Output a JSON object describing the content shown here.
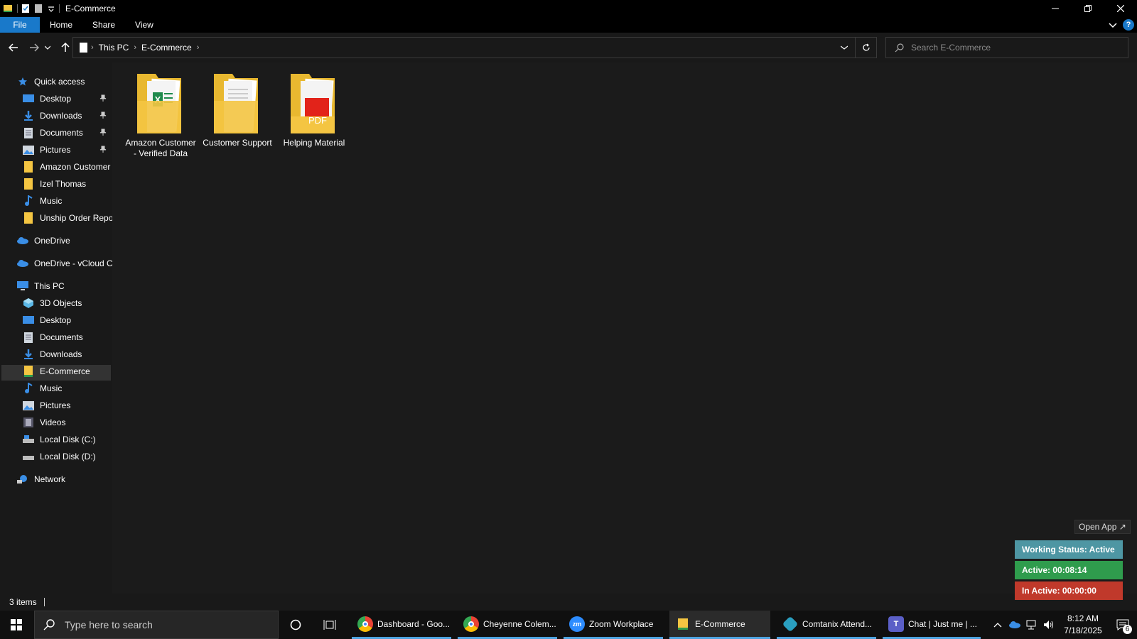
{
  "window": {
    "title": "E-Commerce"
  },
  "ribbon": {
    "tabs": [
      {
        "label": "File"
      },
      {
        "label": "Home"
      },
      {
        "label": "Share"
      },
      {
        "label": "View"
      }
    ],
    "help_label": "?"
  },
  "address": {
    "crumbs": [
      "This PC",
      "E-Commerce"
    ]
  },
  "search": {
    "placeholder": "Search E-Commerce"
  },
  "sidebar": {
    "quick_access": "Quick access",
    "quick_items": [
      {
        "label": "Desktop",
        "icon": "desktop-icon",
        "pinned": true
      },
      {
        "label": "Downloads",
        "icon": "download-icon",
        "pinned": true
      },
      {
        "label": "Documents",
        "icon": "documents-icon",
        "pinned": true
      },
      {
        "label": "Pictures",
        "icon": "pictures-icon",
        "pinned": true
      },
      {
        "label": "Amazon Customer",
        "icon": "folder-icon",
        "pinned": false
      },
      {
        "label": "Izel Thomas",
        "icon": "folder-icon",
        "pinned": false
      },
      {
        "label": "Music",
        "icon": "music-icon",
        "pinned": false
      },
      {
        "label": "Unship Order Report",
        "icon": "folder-icon",
        "pinned": false
      }
    ],
    "onedrive": "OneDrive",
    "onedrive_vcloud": "OneDrive - vCloud Cl",
    "this_pc": "This PC",
    "pc_items": [
      {
        "label": "3D Objects",
        "icon": "3d-objects-icon"
      },
      {
        "label": "Desktop",
        "icon": "desktop-icon"
      },
      {
        "label": "Documents",
        "icon": "documents-icon"
      },
      {
        "label": "Downloads",
        "icon": "download-icon"
      },
      {
        "label": "E-Commerce",
        "icon": "folder-icon",
        "selected": true
      },
      {
        "label": "Music",
        "icon": "music-icon"
      },
      {
        "label": "Pictures",
        "icon": "pictures-icon"
      },
      {
        "label": "Videos",
        "icon": "videos-icon"
      },
      {
        "label": "Local Disk (C:)",
        "icon": "disk-icon"
      },
      {
        "label": "Local Disk (D:)",
        "icon": "disk-icon"
      }
    ],
    "network": "Network"
  },
  "files": [
    {
      "name": "Amazon Customer - Verified Data",
      "icon": "folder-excel-icon"
    },
    {
      "name": "Customer Support",
      "icon": "folder-docs-icon"
    },
    {
      "name": "Helping Material",
      "icon": "folder-pdf-icon"
    }
  ],
  "pdf_label": "PDF",
  "status": {
    "item_count": "3 items"
  },
  "widget": {
    "open_app": "Open App ↗",
    "working_status": "Working Status: Active",
    "active": "Active: 00:08:14",
    "inactive": "In Active: 00:00:00"
  },
  "taskbar": {
    "search_placeholder": "Type here to search",
    "apps": [
      {
        "label": "Dashboard - Goo...",
        "icon": "chrome-icon"
      },
      {
        "label": "Cheyenne Colem...",
        "icon": "chrome-icon"
      },
      {
        "label": "Zoom Workplace",
        "icon": "zoom-icon",
        "icon_text": "zm"
      },
      {
        "label": "E-Commerce",
        "icon": "file-explorer-icon",
        "active": true
      },
      {
        "label": "Comtanix Attend...",
        "icon": "comtanix-icon"
      },
      {
        "label": "Chat | Just me | ...",
        "icon": "teams-icon"
      }
    ],
    "clock_time": "8:12 AM",
    "clock_date": "7/18/2025",
    "notification_count": "6"
  },
  "colors": {
    "accent": "#1979ca",
    "folder": "#f4c542",
    "working": "#4e96a3",
    "active": "#2f9c4d",
    "inactive": "#c0392b"
  }
}
